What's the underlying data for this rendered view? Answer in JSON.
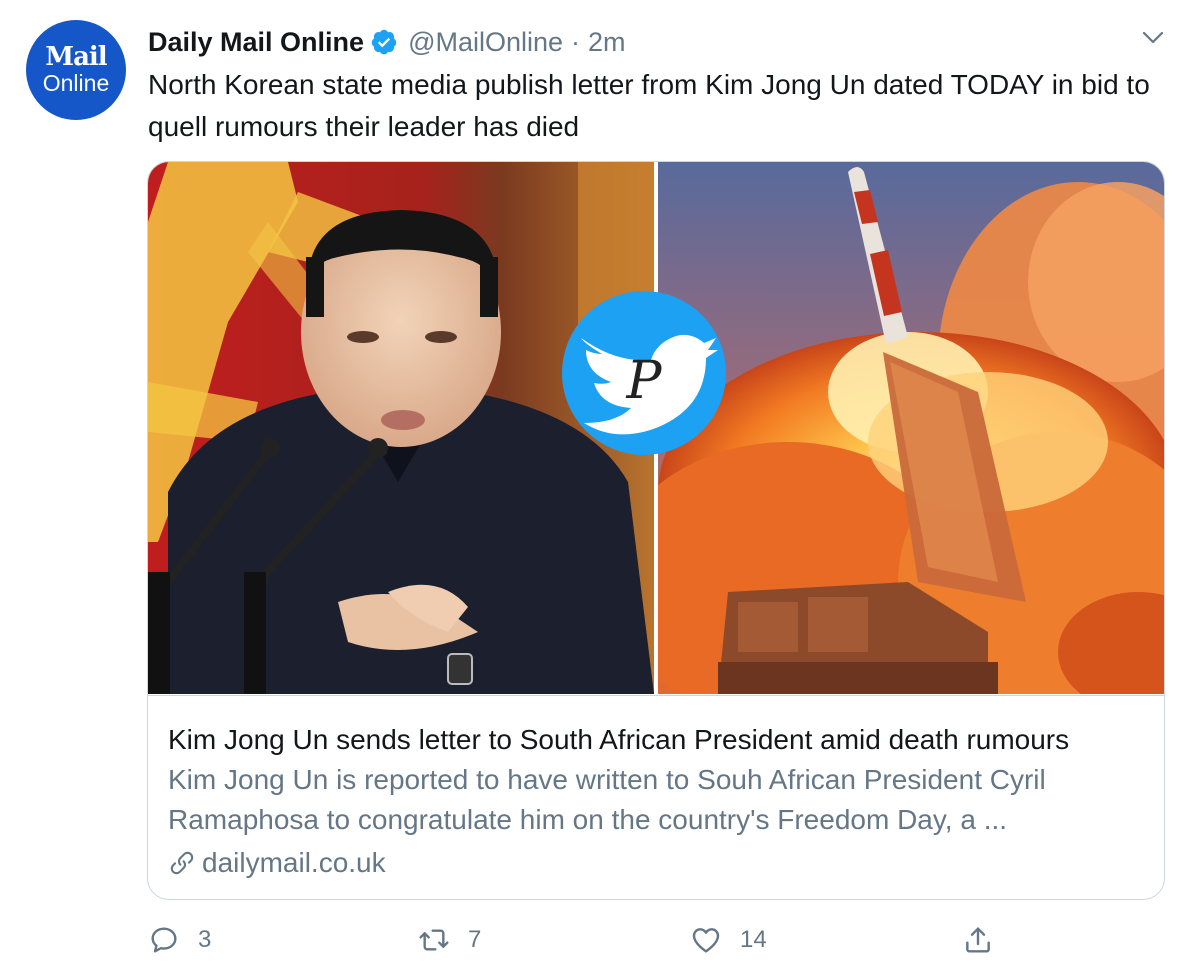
{
  "tweet": {
    "avatar": {
      "line1": "Mail",
      "line2": "Online"
    },
    "author": "Daily Mail Online",
    "handle": "@MailOnline",
    "separator": "·",
    "time": "2m",
    "text": "North Korean state media publish letter from Kim Jong Un dated TODAY in bid to quell rumours their leader has died"
  },
  "card": {
    "title": "Kim Jong Un sends letter to South African President amid death rumours",
    "description": "Kim Jong Un is reported to have written to Souh African President Cyril Ramaphosa to congratulate him on the country's Freedom Day, a ...",
    "domain": "dailymail.co.uk"
  },
  "actions": {
    "replies": "3",
    "retweets": "7",
    "likes": "14"
  },
  "icons": {
    "verified": "verified-badge-icon",
    "menu": "chevron-down-icon",
    "reply": "comment-icon",
    "retweet": "retweet-icon",
    "like": "heart-icon",
    "share": "share-icon",
    "link": "link-icon"
  },
  "colors": {
    "brand_blue": "#1556c8",
    "twitter_blue": "#1da1f2",
    "secondary_text": "#657786"
  }
}
